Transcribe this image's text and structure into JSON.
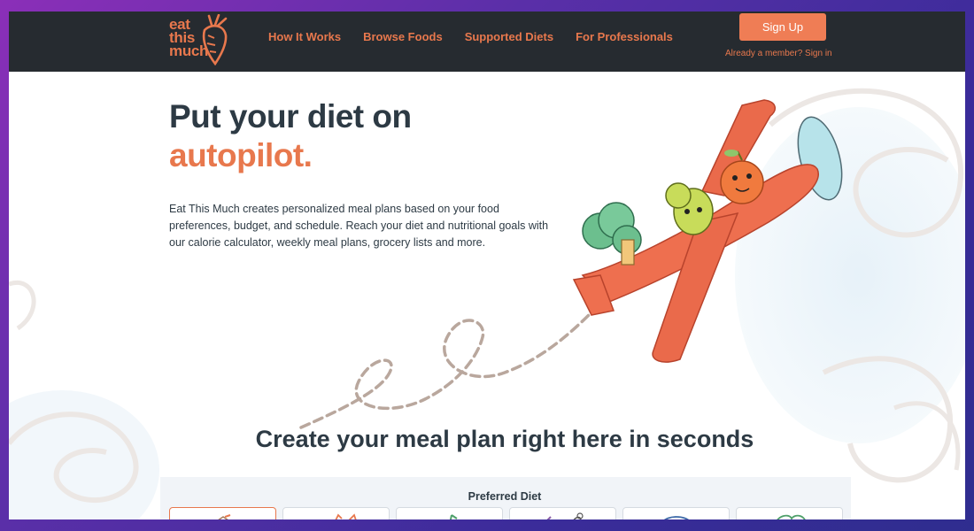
{
  "brand": {
    "logo_line1": "eat",
    "logo_line2": "this",
    "logo_line3": "much",
    "accent_color": "#e8784d"
  },
  "nav": {
    "items": [
      {
        "label": "How It Works"
      },
      {
        "label": "Browse Foods"
      },
      {
        "label": "Supported Diets"
      },
      {
        "label": "For Professionals"
      }
    ],
    "signup_label": "Sign Up",
    "signin_label": "Already a member? Sign in"
  },
  "hero": {
    "title_line1": "Put your diet on",
    "title_line2": "autopilot.",
    "description": "Eat This Much creates personalized meal plans based on your food preferences, budget, and schedule. Reach your diet and nutritional goals with our calorie calculator, weekly meal plans, grocery lists and more.",
    "illustration": "airplane-with-fruits-illustration"
  },
  "meal_plan": {
    "title": "Create your meal plan right here in seconds",
    "preferred_diet_label": "Preferred Diet",
    "diet_options": [
      {
        "icon": "anything-icon",
        "selected": true
      },
      {
        "icon": "paleo-icon",
        "selected": false
      },
      {
        "icon": "vegetarian-icon",
        "selected": false
      },
      {
        "icon": "vegan-icon",
        "selected": false
      },
      {
        "icon": "ketogenic-icon",
        "selected": false
      },
      {
        "icon": "mediterranean-icon",
        "selected": false
      }
    ]
  }
}
